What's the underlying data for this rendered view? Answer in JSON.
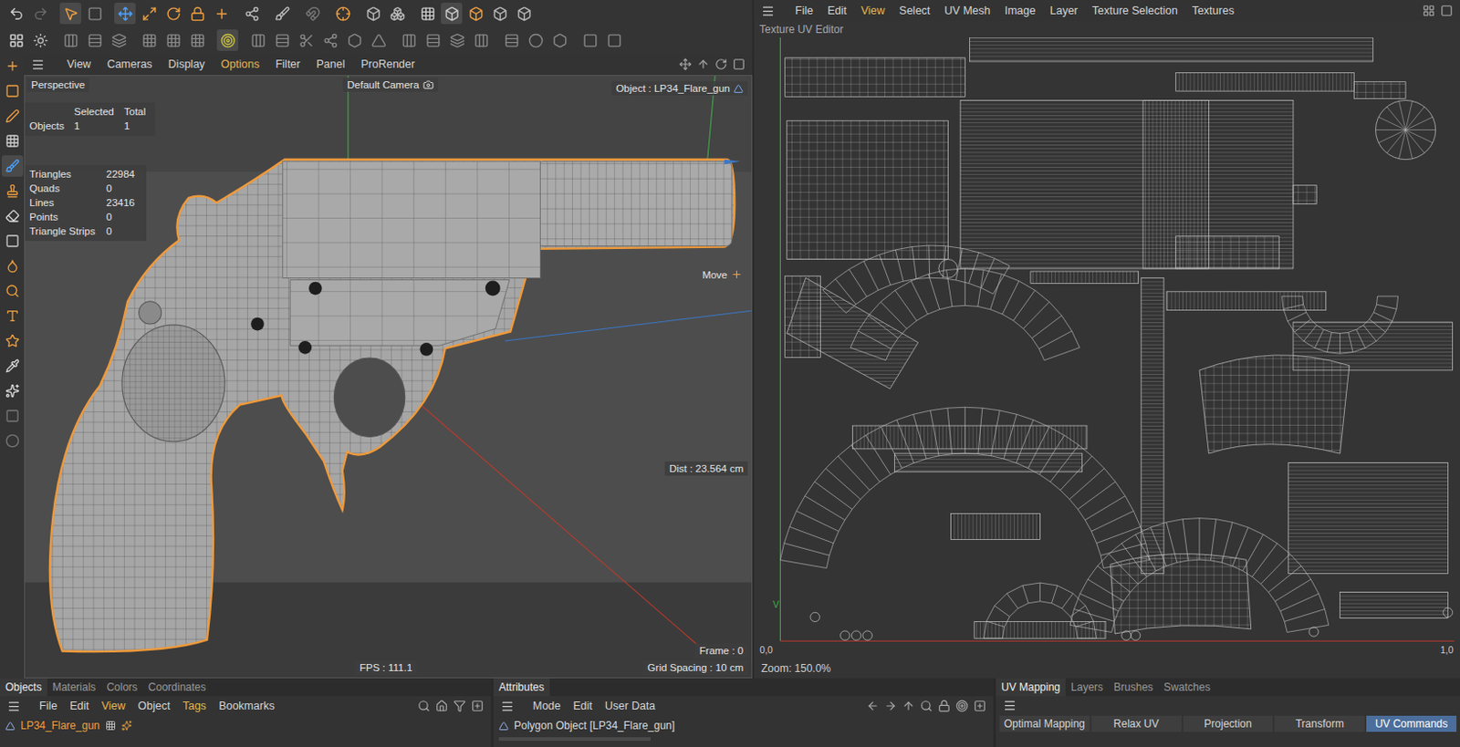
{
  "viewport": {
    "menu": [
      {
        "label": "View",
        "highlighted": false
      },
      {
        "label": "Cameras",
        "highlighted": false
      },
      {
        "label": "Display",
        "highlighted": false
      },
      {
        "label": "Options",
        "highlighted": true
      },
      {
        "label": "Filter",
        "highlighted": false
      },
      {
        "label": "Panel",
        "highlighted": false
      },
      {
        "label": "ProRender",
        "highlighted": false
      }
    ],
    "view_name": "Perspective",
    "camera": "Default Camera",
    "object_label": "Object : LP34_Flare_gun",
    "stats_header": [
      "Selected",
      "Total"
    ],
    "stats_row": {
      "label": "Objects",
      "selected": "1",
      "total": "1"
    },
    "mesh_stats": [
      {
        "label": "Triangles",
        "value": "22984"
      },
      {
        "label": "Quads",
        "value": "0"
      },
      {
        "label": "Lines",
        "value": "23416"
      },
      {
        "label": "Points",
        "value": "0"
      },
      {
        "label": "Triangle Strips",
        "value": "0"
      }
    ],
    "tool_label": "Move",
    "distance": "Dist : 23.564 cm",
    "fps": "FPS : 111.1",
    "frame": "Frame : 0",
    "grid_spacing": "Grid Spacing : 10 cm"
  },
  "uv_editor": {
    "menu": [
      {
        "label": "File",
        "highlighted": false
      },
      {
        "label": "Edit",
        "highlighted": false
      },
      {
        "label": "View",
        "highlighted": true
      },
      {
        "label": "Select",
        "highlighted": false
      },
      {
        "label": "UV Mesh",
        "highlighted": false
      },
      {
        "label": "Image",
        "highlighted": false
      },
      {
        "label": "Layer",
        "highlighted": false
      },
      {
        "label": "Texture Selection",
        "highlighted": false
      },
      {
        "label": "Textures",
        "highlighted": false
      }
    ],
    "title": "Texture UV Editor",
    "v_axis": "V",
    "origin": "0,0",
    "u_end": "1,0",
    "zoom": "Zoom: 150.0%"
  },
  "objects_panel": {
    "tabs": [
      {
        "label": "Objects",
        "selected": true
      },
      {
        "label": "Materials",
        "selected": false
      },
      {
        "label": "Colors",
        "selected": false
      },
      {
        "label": "Coordinates",
        "selected": false
      }
    ],
    "menu": [
      {
        "label": "File",
        "highlighted": false
      },
      {
        "label": "Edit",
        "highlighted": false
      },
      {
        "label": "View",
        "highlighted": true
      },
      {
        "label": "Object",
        "highlighted": false
      },
      {
        "label": "Tags",
        "highlighted": true
      },
      {
        "label": "Bookmarks",
        "highlighted": false
      }
    ],
    "objects": [
      {
        "name": "LP34_Flare_gun",
        "selected": true
      }
    ]
  },
  "attributes_panel": {
    "tabs": [
      {
        "label": "Attributes",
        "selected": true
      }
    ],
    "menu": [
      {
        "label": "Mode",
        "highlighted": false
      },
      {
        "label": "Edit",
        "highlighted": false
      },
      {
        "label": "User Data",
        "highlighted": false
      }
    ],
    "title": "Polygon Object [LP34_Flare_gun]"
  },
  "uv_panel": {
    "tabs": [
      {
        "label": "UV Mapping",
        "selected": true
      },
      {
        "label": "Layers",
        "selected": false
      },
      {
        "label": "Brushes",
        "selected": false
      },
      {
        "label": "Swatches",
        "selected": false
      }
    ],
    "commands": [
      {
        "label": "Optimal Mapping",
        "selected": false
      },
      {
        "label": "Relax UV",
        "selected": false
      },
      {
        "label": "Projection",
        "selected": false
      },
      {
        "label": "Transform",
        "selected": false
      },
      {
        "label": "UV Commands",
        "selected": true
      }
    ]
  }
}
